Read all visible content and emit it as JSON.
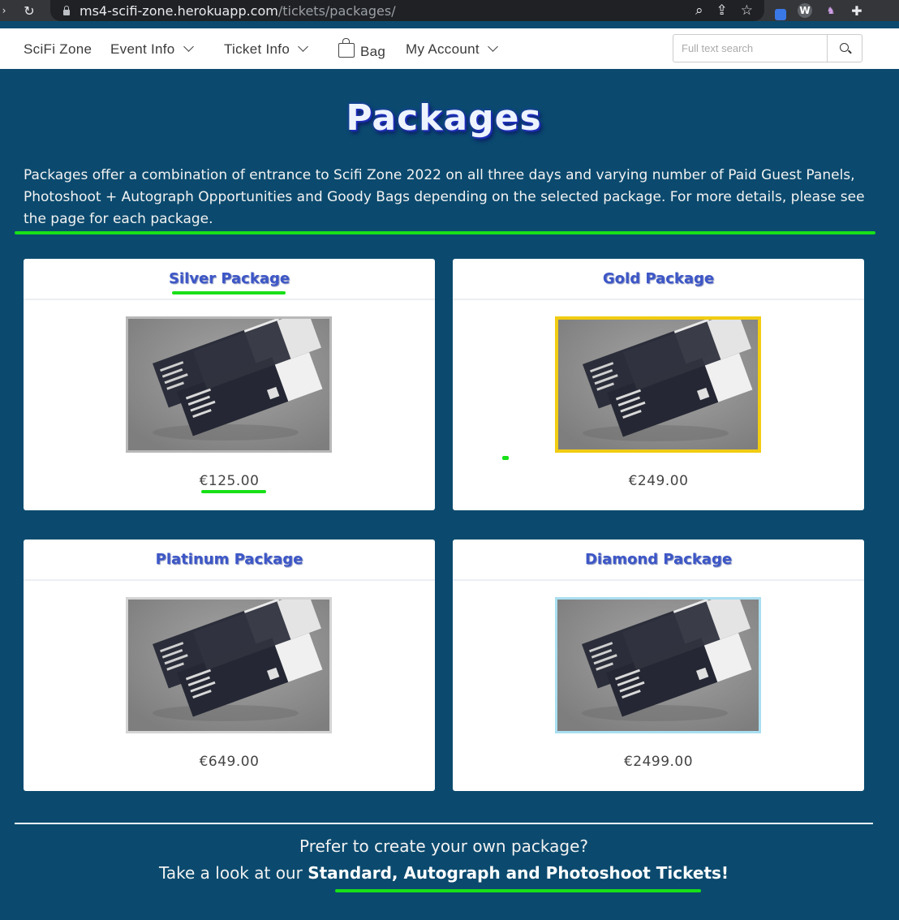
{
  "browser": {
    "url_host": "ms4-scifi-zone.herokuapp.com",
    "url_path": "/tickets/packages/"
  },
  "nav": {
    "brand": "SciFi Zone",
    "event_info": "Event Info",
    "ticket_info": "Ticket Info",
    "bag": "Bag",
    "my_account": "My Account",
    "search_placeholder": "Full text search"
  },
  "page": {
    "title": "Packages",
    "intro": "Packages offer a combination of entrance to Scifi Zone 2022 on all three days and varying number of Paid Guest Panels, Photoshoot + Autograph Opportunities and Goody Bags depending on the selected package. For more details, please see the page for each package."
  },
  "packages": [
    {
      "name": "Silver Package",
      "price": "€125.00",
      "frame_color": "#b8b8b8"
    },
    {
      "name": "Gold Package",
      "price": "€249.00",
      "frame_color": "#f1cc12"
    },
    {
      "name": "Platinum Package",
      "price": "€649.00",
      "frame_color": "#d4d4d4"
    },
    {
      "name": "Diamond Package",
      "price": "€2499.00",
      "frame_color": "#a9dff0"
    }
  ],
  "cta": {
    "line1": "Prefer to create your own package?",
    "line2_prefix": "Take a look at our",
    "link": "Standard, Autograph and Photoshoot Tickets!"
  },
  "colors": {
    "page_bg": "#0b4a6e",
    "highlight": "#18e018",
    "card_title": "#3d57c7"
  }
}
